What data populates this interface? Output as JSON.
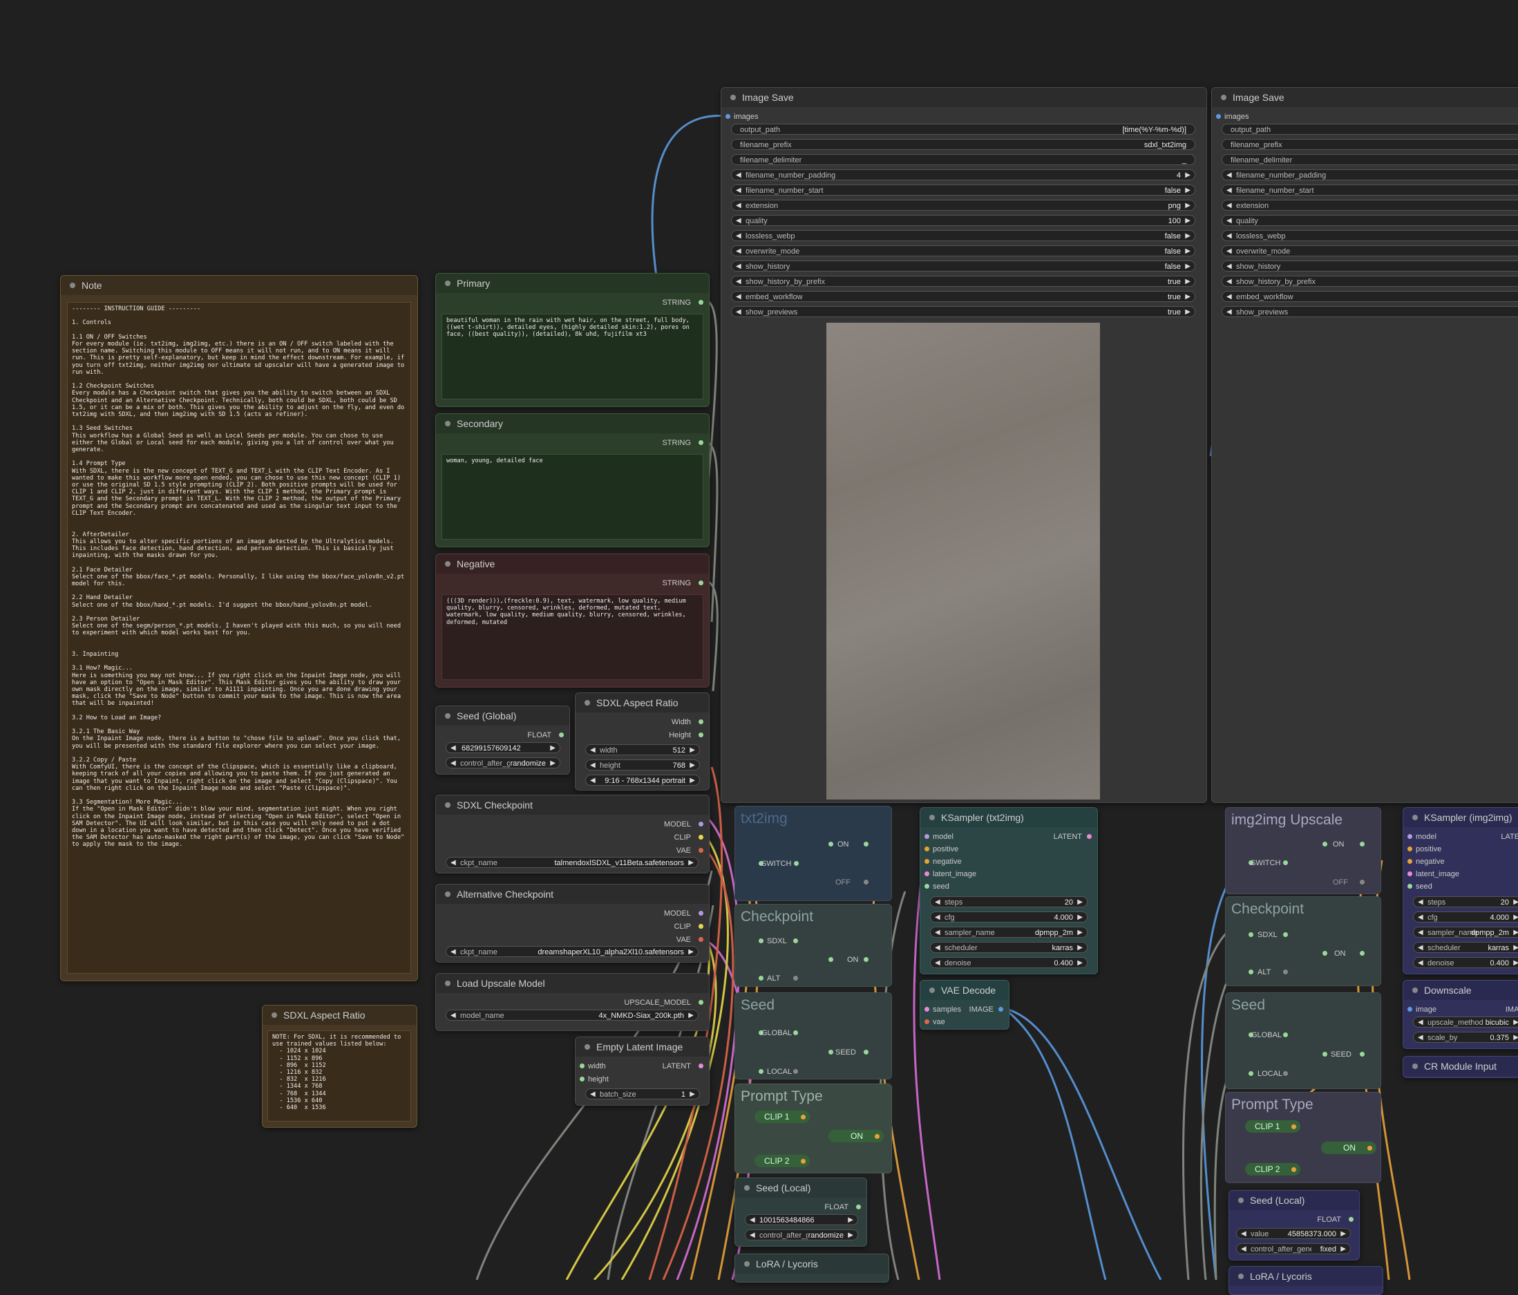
{
  "note": {
    "title": "Note",
    "body": "-------- INSTRUCTION GUIDE ---------\n\n1. Controls\n\n1.1 ON / OFF Switches\nFor every module (ie. txt2img, img2img, etc.) there is an ON / OFF switch labeled with the section name. Switching this module to OFF means it will not run, and to ON means it will run. This is pretty self-explanatory, but keep in mind the effect downstream. For example, if you turn off txt2img, neither img2img nor ultimate sd upscaler will have a generated image to run with.\n\n1.2 Checkpoint Switches\nEvery module has a Checkpoint switch that gives you the ability to switch between an SDXL Checkpoint and an Alternative Checkpoint. Technically, both could be SDXL, both could be SD 1.5, or it can be a mix of both. This gives you the ability to adjust on the fly, and even do txt2img with SDXL, and then img2img with SD 1.5 (acts as refiner).\n\n1.3 Seed Switches\nThis workflow has a Global Seed as well as Local Seeds per module. You can chose to use either the Global or Local seed for each module, giving you a lot of control over what you generate.\n\n1.4 Prompt Type\nWith SDXL, there is the new concept of TEXT_G and TEXT_L with the CLIP Text Encoder. As I wanted to make this workflow more open ended, you can chose to use this new concept (CLIP 1) or use the original SD 1.5 style prompting (CLIP 2). Both positive prompts will be used for CLIP 1 and CLIP 2, just in different ways. With the CLIP 1 method, the Primary prompt is TEXT_G and the Secondary prompt is TEXT_L. With the CLIP 2 method, the output of the Primary prompt and the Secondary prompt are concatenated and used as the singular text input to the CLIP Text Encoder.\n\n\n2. AfterDetailer\nThis allows you to alter specific portions of an image detected by the Ultralytics models. This includes face detection, hand detection, and person detection. This is basically just inpainting, with the masks drawn for you.\n\n2.1 Face Detailer\nSelect one of the bbox/face_*.pt models. Personally, I like using the bbox/face_yolov8n_v2.pt model for this.\n\n2.2 Hand Detailer\nSelect one of the bbox/hand_*.pt models. I'd suggest the bbox/hand_yolov8n.pt model.\n\n2.3 Person Detailer\nSelect one of the segm/person_*.pt models. I haven't played with this much, so you will need to experiment with which model works best for you.\n\n\n3. Inpainting\n\n3.1 How? Magic...\nHere is something you may not know... If you right click on the Inpaint Image node, you will have an option to \"Open in Mask Editor\". This Mask Editor gives you the ability to draw your own mask directly on the image, similar to A1111 inpainting. Once you are done drawing your mask, click the \"Save to Node\" button to commit your mask to the image. This is now the area that will be inpainted!\n\n3.2 How to Load an Image?\n\n3.2.1 The Basic Way\nOn the Inpaint Image node, there is a button to \"chose file to upload\". Once you click that, you will be presented with the standard file explorer where you can select your image.\n\n3.2.2 Copy / Paste\nWith ComfyUI, there is the concept of the Clipspace, which is essentially like a clipboard, keeping track of all your copies and allowing you to paste them. If you just generated an image that you want to Inpaint, right click on the image and select \"Copy (Clipspace)\". You can then right click on the Inpaint Image node and select \"Paste (Clipspace)\".\n\n3.3 Segmentation! More Magic...\nIf the \"Open in Mask Editor\" didn't blow your mind, segmentation just might. When you right click on the Inpaint Image node, instead of selecting \"Open in Mask Editor\", select \"Open in SAM Detector\". The UI will look similar, but in this case you will only need to put a dot down in a location you want to have detected and then click \"Detect\". Once you have verified the SAM Detector has auto-masked the right part(s) of the image, you can click \"Save to Node\" to apply the mask to the image."
  },
  "aspect_note": {
    "title": "SDXL Aspect Ratio",
    "body": "NOTE: For SDXL, it is recommended to\nuse trained values listed below:\n  - 1024 x 1024\n  - 1152 x 896\n  - 896  x 1152\n  - 1216 x 832\n  - 832  x 1216\n  - 1344 x 768\n  - 768  x 1344\n  - 1536 x 640\n  - 640  x 1536"
  },
  "primary": {
    "title": "Primary",
    "output": "STRING",
    "text": "beautiful woman in the rain with wet hair, on the street, full body, ((wet t-shirt)), detailed eyes, (highly detailed skin:1.2), pores on face, ((best quality)), (detailed), 8k uhd, fujifilm xt3"
  },
  "secondary": {
    "title": "Secondary",
    "output": "STRING",
    "text": "woman, young, detailed face"
  },
  "negative": {
    "title": "Negative",
    "output": "STRING",
    "text": "(((3D render))),(freckle:0.9), text, watermark, low quality, medium quality, blurry, censored, wrinkles, deformed, mutated text, watermark, low quality, medium quality, blurry, censored, wrinkles, deformed, mutated"
  },
  "seed_global": {
    "title": "Seed (Global)",
    "output": "FLOAT",
    "seed_value": "68299157609142",
    "control_label": "control_after_generate",
    "control_value": "randomize"
  },
  "aspect_ratio": {
    "title": "SDXL Aspect Ratio",
    "out_width": "Width",
    "out_height": "Height",
    "width_label": "width",
    "width_value": "512",
    "height_label": "height",
    "height_value": "768",
    "preset_value": "9:16 - 768x1344 portrait"
  },
  "sdxl_checkpoint": {
    "title": "SDXL Checkpoint",
    "outputs": [
      "MODEL",
      "CLIP",
      "VAE"
    ],
    "ckpt_label": "ckpt_name",
    "ckpt_value": "talmendoxlSDXL_v11Beta.safetensors"
  },
  "alt_checkpoint": {
    "title": "Alternative Checkpoint",
    "outputs": [
      "MODEL",
      "CLIP",
      "VAE"
    ],
    "ckpt_label": "ckpt_name",
    "ckpt_value": "dreamshaperXL10_alpha2Xl10.safetensors"
  },
  "upscale_model": {
    "title": "Load Upscale Model",
    "output": "UPSCALE_MODEL",
    "model_label": "model_name",
    "model_value": "4x_NMKD-Siax_200k.pth"
  },
  "empty_latent": {
    "title": "Empty Latent Image",
    "in_width": "width",
    "in_height": "height",
    "output": "LATENT",
    "batch_label": "batch_size",
    "batch_value": "1"
  },
  "image_save_1": {
    "title": "Image Save",
    "input": "images",
    "fields": [
      {
        "label": "output_path",
        "value": "[time(%Y-%m-%d)]",
        "arrows": false
      },
      {
        "label": "filename_prefix",
        "value": "sdxl_txt2img",
        "arrows": false
      },
      {
        "label": "filename_delimiter",
        "value": "_",
        "arrows": false
      },
      {
        "label": "filename_number_padding",
        "value": "4",
        "arrows": true
      },
      {
        "label": "filename_number_start",
        "value": "false",
        "arrows": true
      },
      {
        "label": "extension",
        "value": "png",
        "arrows": true
      },
      {
        "label": "quality",
        "value": "100",
        "arrows": true
      },
      {
        "label": "lossless_webp",
        "value": "false",
        "arrows": true
      },
      {
        "label": "overwrite_mode",
        "value": "false",
        "arrows": true
      },
      {
        "label": "show_history",
        "value": "false",
        "arrows": true
      },
      {
        "label": "show_history_by_prefix",
        "value": "true",
        "arrows": true
      },
      {
        "label": "embed_workflow",
        "value": "true",
        "arrows": true
      },
      {
        "label": "show_previews",
        "value": "true",
        "arrows": true
      }
    ]
  },
  "image_save_2": {
    "title": "Image Save",
    "input": "images",
    "fields": [
      {
        "label": "output_path",
        "arrows": false
      },
      {
        "label": "filename_prefix",
        "arrows": false
      },
      {
        "label": "filename_delimiter",
        "arrows": false
      },
      {
        "label": "filename_number_padding",
        "arrows": true
      },
      {
        "label": "filename_number_start",
        "arrows": true
      },
      {
        "label": "extension",
        "arrows": true
      },
      {
        "label": "quality",
        "arrows": true
      },
      {
        "label": "lossless_webp",
        "arrows": true
      },
      {
        "label": "overwrite_mode",
        "arrows": true
      },
      {
        "label": "show_history",
        "arrows": true
      },
      {
        "label": "show_history_by_prefix",
        "arrows": true
      },
      {
        "label": "embed_workflow",
        "arrows": true
      },
      {
        "label": "show_previews",
        "arrows": true
      }
    ]
  },
  "txt2img_group": {
    "title": "txt2img",
    "switch": "SWITCH",
    "on": "ON",
    "off": "OFF",
    "checkpoint_title": "Checkpoint",
    "sdxl": "SDXL",
    "alt": "ALT",
    "seed_title": "Seed",
    "global": "GLOBAL",
    "local": "LOCAL",
    "seed_out": "SEED",
    "prompt_title": "Prompt Type",
    "clip1": "CLIP 1",
    "clip2": "CLIP 2"
  },
  "img2img_group": {
    "title": "img2img Upscale",
    "switch": "SWITCH",
    "on": "ON",
    "off": "OFF",
    "checkpoint_title": "Checkpoint",
    "sdxl": "SDXL",
    "alt": "ALT",
    "seed_title": "Seed",
    "global": "GLOBAL",
    "local": "LOCAL",
    "seed_out": "SEED",
    "prompt_title": "Prompt Type",
    "clip1": "CLIP 1",
    "clip2": "CLIP 2"
  },
  "ksampler_txt": {
    "title": "KSampler (txt2img)",
    "inputs": [
      "model",
      "positive",
      "negative",
      "latent_image",
      "seed"
    ],
    "output": "LATENT",
    "widgets": [
      {
        "label": "steps",
        "value": "20"
      },
      {
        "label": "cfg",
        "value": "4.000"
      },
      {
        "label": "sampler_name",
        "value": "dpmpp_2m"
      },
      {
        "label": "scheduler",
        "value": "karras"
      },
      {
        "label": "denoise",
        "value": "0.400"
      }
    ]
  },
  "ksampler_img": {
    "title": "KSampler (img2img)",
    "inputs": [
      "model",
      "positive",
      "negative",
      "latent_image",
      "seed"
    ],
    "output": "LATEN",
    "widgets": [
      {
        "label": "steps",
        "value": "20"
      },
      {
        "label": "cfg",
        "value": "4.000"
      },
      {
        "label": "sampler_name",
        "value": "dpmpp_2m"
      },
      {
        "label": "scheduler",
        "value": "karras"
      },
      {
        "label": "denoise",
        "value": "0.400"
      }
    ]
  },
  "vae_decode": {
    "title": "VAE Decode",
    "inputs": [
      "samples",
      "vae"
    ],
    "output": "IMAGE"
  },
  "downscale": {
    "title": "Downscale",
    "input": "image",
    "output": "IMAG",
    "widgets": [
      {
        "label": "upscale_method",
        "value": "bicubic"
      },
      {
        "label": "scale_by",
        "value": "0.375"
      }
    ]
  },
  "cr_module": {
    "title": "CR Module Input"
  },
  "seed_local_1": {
    "title": "Seed (Local)",
    "output": "FLOAT",
    "seed_value": "1001563484866",
    "control_label": "control_after_generate",
    "control_value": "randomize"
  },
  "seed_local_2": {
    "title": "Seed (Local)",
    "output": "FLOAT",
    "value_label": "value",
    "value": "45858373.000",
    "control_label": "control_after_generate",
    "control_value": "fixed"
  },
  "lora_1": {
    "title": "LoRA / Lycoris"
  },
  "lora_2": {
    "title": "LoRA / Lycoris"
  },
  "colors": {
    "canvas": "#202020",
    "node": "#353535",
    "green_node": "#2c3f2a",
    "red_node": "#3f2929",
    "brown_note": "#473825",
    "teal_node": "#2b4645",
    "blue_node": "#30305a",
    "wire_blue": "#5a9be0",
    "wire_orange": "#e8a23a",
    "wire_pink": "#d86fd8",
    "wire_yellow": "#e8d94a",
    "wire_gray": "#8a9088"
  }
}
